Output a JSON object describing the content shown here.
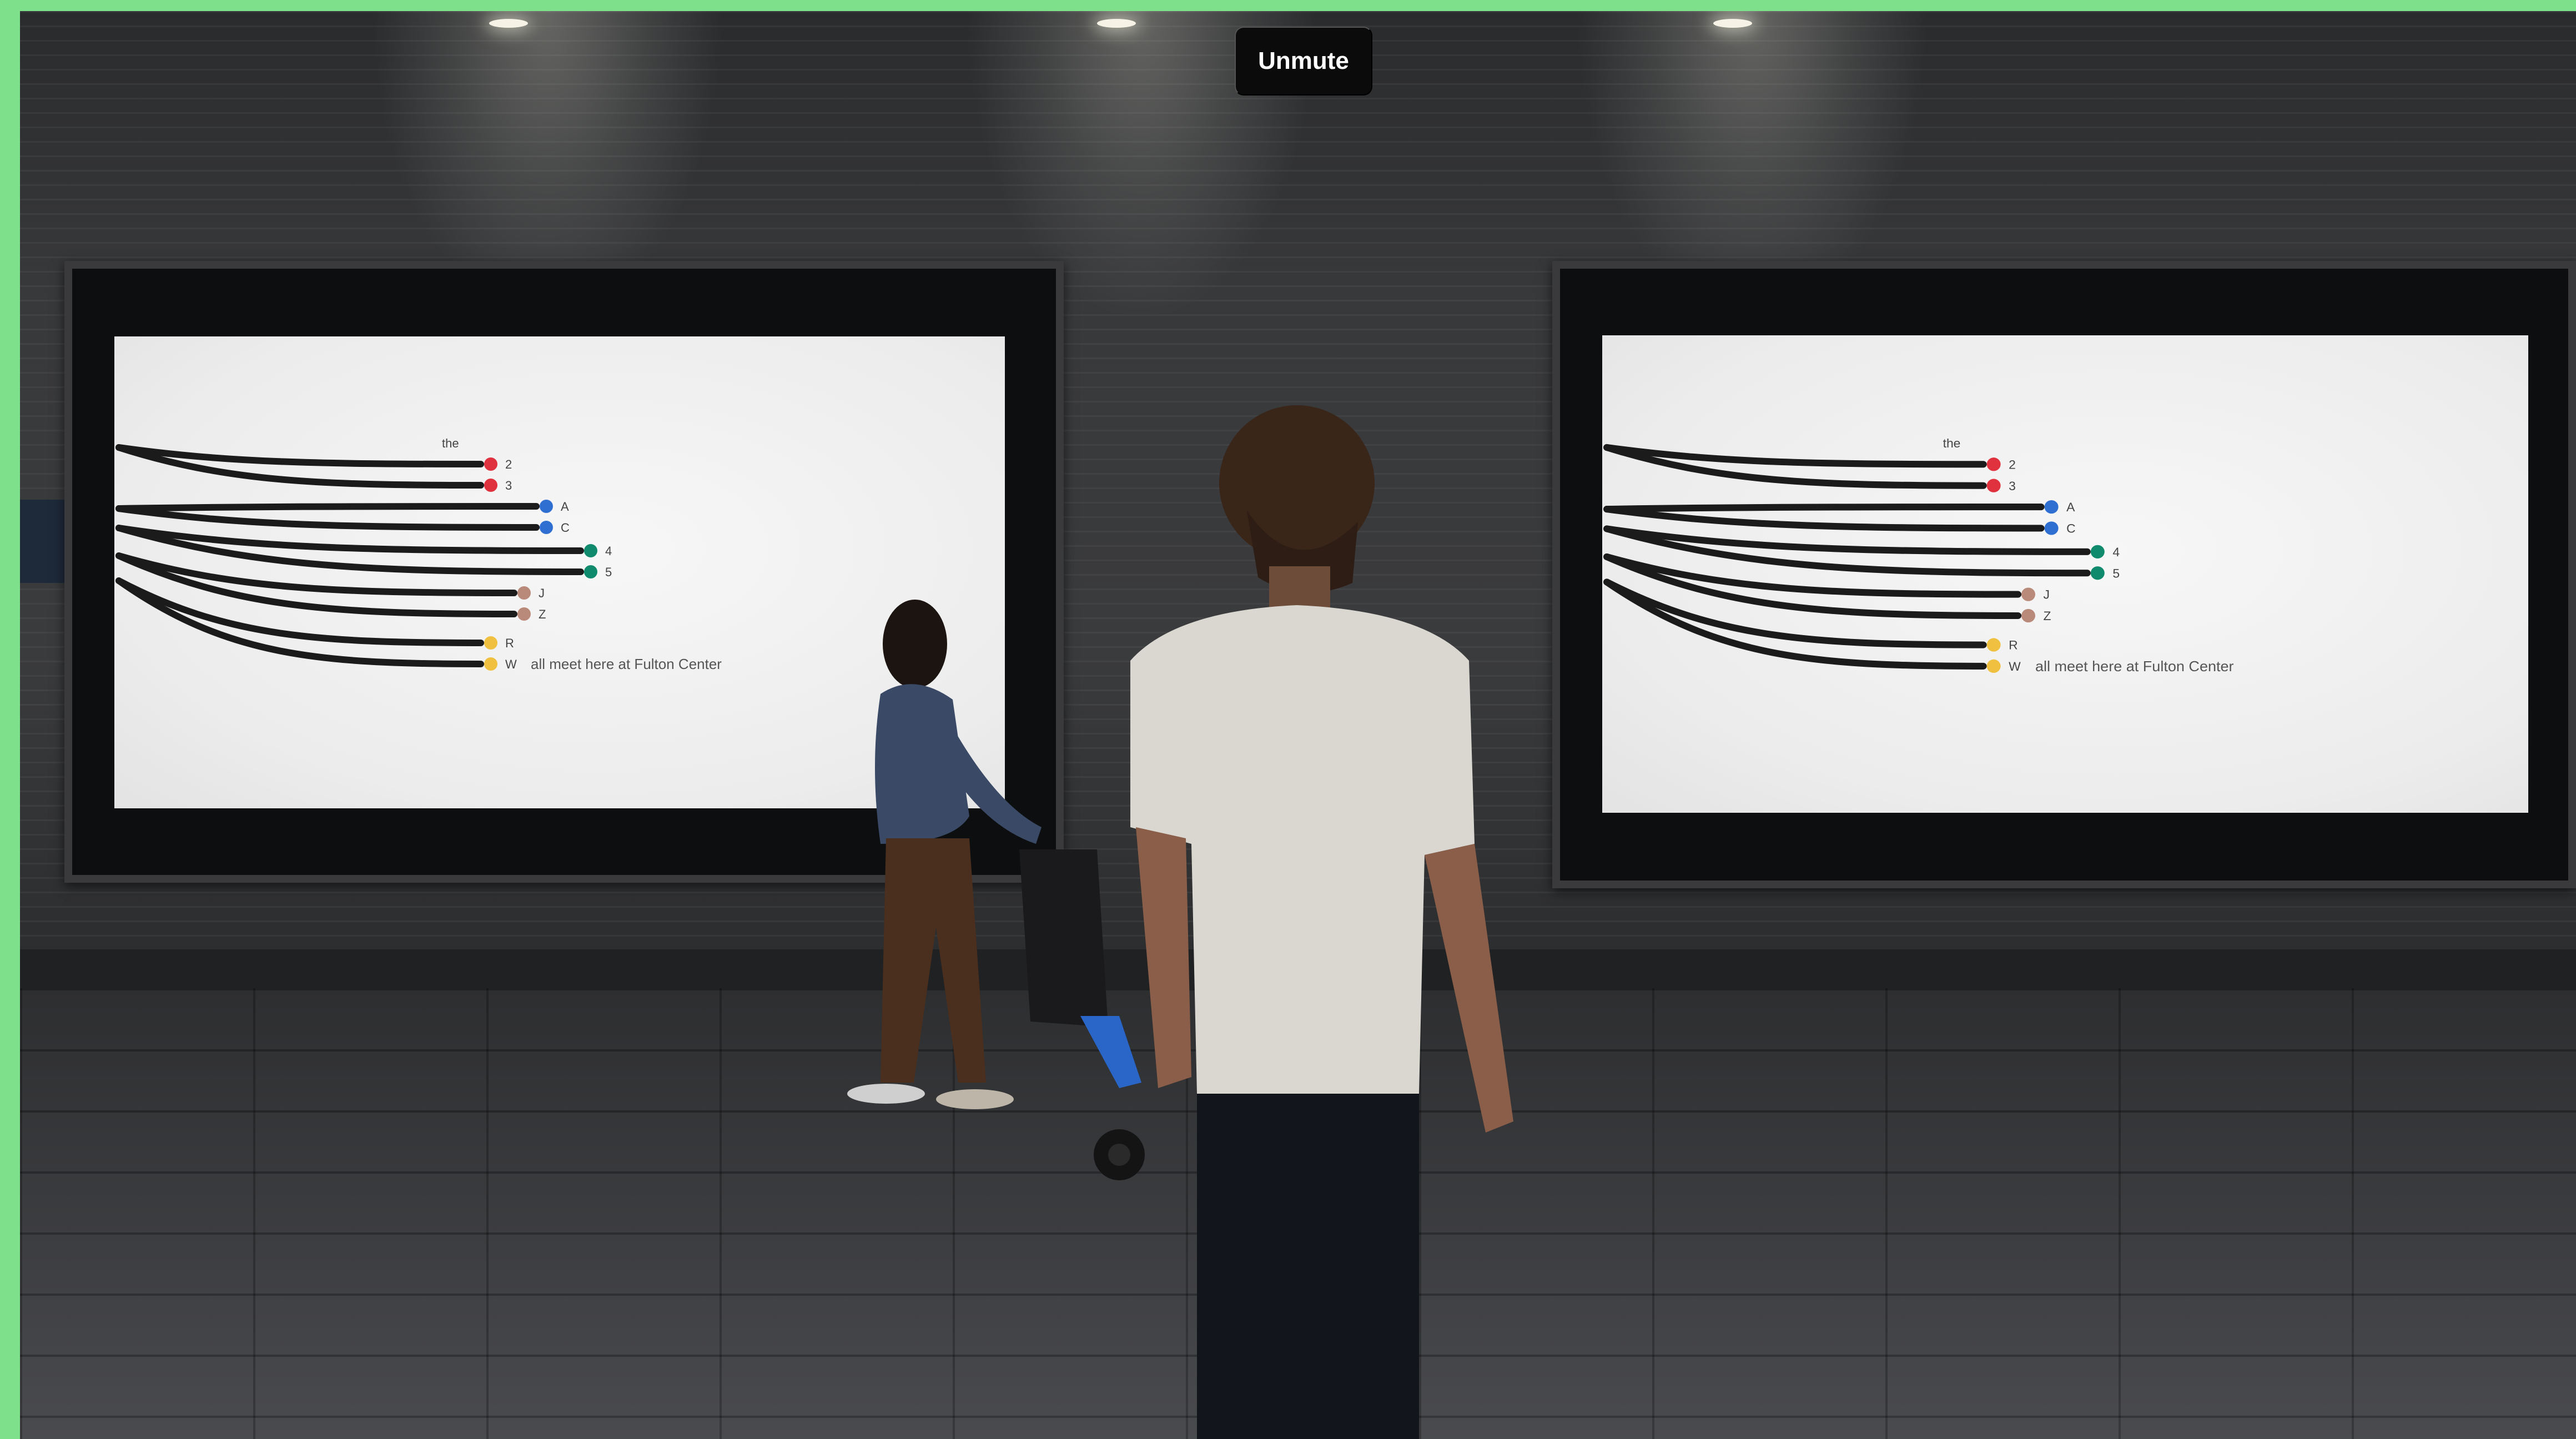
{
  "player": {
    "unmute_label": "Unmute"
  },
  "billboards": [
    {
      "intro_word": "the",
      "routes": [
        {
          "label": "2",
          "color": "#e0323e"
        },
        {
          "label": "3",
          "color": "#e0323e"
        },
        {
          "label": "A",
          "color": "#2f6fd1"
        },
        {
          "label": "C",
          "color": "#2f6fd1"
        },
        {
          "label": "4",
          "color": "#0f8a6c"
        },
        {
          "label": "5",
          "color": "#0f8a6c"
        },
        {
          "label": "J",
          "color": "#b98a7a"
        },
        {
          "label": "Z",
          "color": "#b98a7a"
        },
        {
          "label": "R",
          "color": "#f0c040"
        },
        {
          "label": "W",
          "color": "#f0c040"
        }
      ],
      "caption": "all meet here at Fulton Center"
    },
    {
      "intro_word": "the",
      "routes": [
        {
          "label": "2",
          "color": "#e0323e"
        },
        {
          "label": "3",
          "color": "#e0323e"
        },
        {
          "label": "A",
          "color": "#2f6fd1"
        },
        {
          "label": "C",
          "color": "#2f6fd1"
        },
        {
          "label": "4",
          "color": "#0f8a6c"
        },
        {
          "label": "5",
          "color": "#0f8a6c"
        },
        {
          "label": "J",
          "color": "#b98a7a"
        },
        {
          "label": "Z",
          "color": "#b98a7a"
        },
        {
          "label": "R",
          "color": "#f0c040"
        },
        {
          "label": "W",
          "color": "#f0c040"
        }
      ],
      "caption": "all meet here at Fulton Center"
    }
  ]
}
